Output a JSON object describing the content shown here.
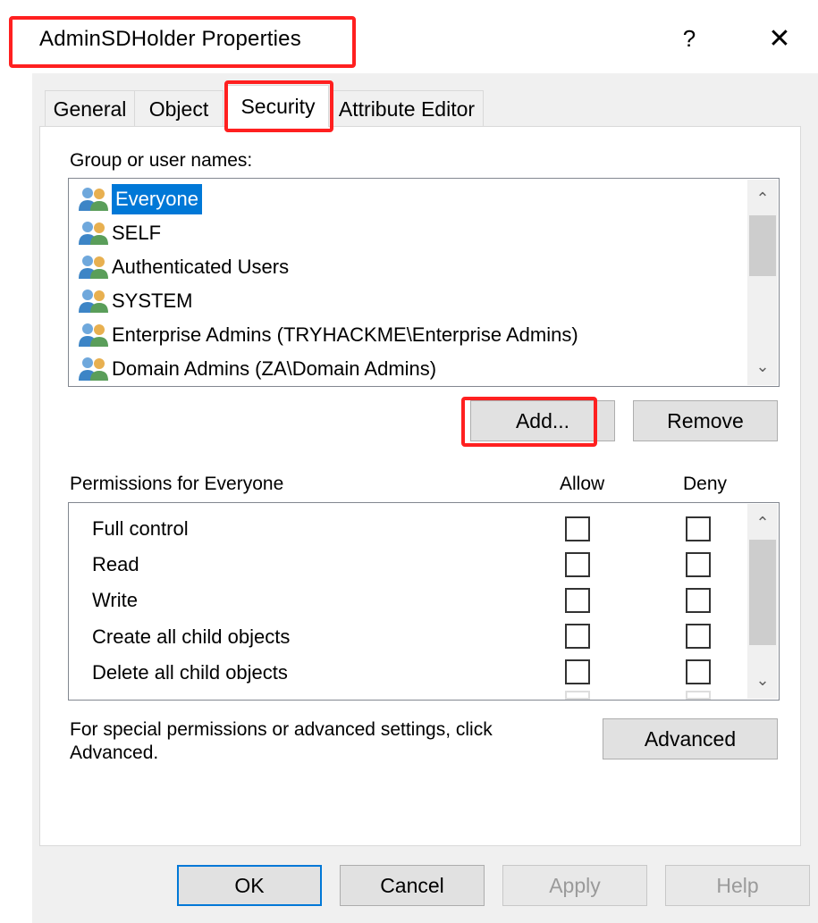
{
  "window": {
    "title": "AdminSDHolder Properties",
    "help_glyph": "?",
    "close_glyph": "✕"
  },
  "tabs": [
    {
      "label": "General",
      "active": false
    },
    {
      "label": "Object",
      "active": false
    },
    {
      "label": "Security",
      "active": true
    },
    {
      "label": "Attribute Editor",
      "active": false
    }
  ],
  "security": {
    "group_label": "Group or user names:",
    "users": [
      {
        "name": "Everyone",
        "selected": true,
        "icon": "users-group-icon"
      },
      {
        "name": "SELF",
        "selected": false,
        "icon": "users-group-icon"
      },
      {
        "name": "Authenticated Users",
        "selected": false,
        "icon": "users-group-icon"
      },
      {
        "name": "SYSTEM",
        "selected": false,
        "icon": "users-group-icon"
      },
      {
        "name": "Enterprise Admins (TRYHACKME\\Enterprise Admins)",
        "selected": false,
        "icon": "users-group-icon"
      },
      {
        "name": "Domain Admins (ZA\\Domain Admins)",
        "selected": false,
        "icon": "users-group-icon"
      }
    ],
    "add_label": "Add...",
    "remove_label": "Remove",
    "permissions_label": "Permissions for Everyone",
    "allow_header": "Allow",
    "deny_header": "Deny",
    "permissions": [
      {
        "name": "Full control",
        "allow": false,
        "deny": false
      },
      {
        "name": "Read",
        "allow": false,
        "deny": false
      },
      {
        "name": "Write",
        "allow": false,
        "deny": false
      },
      {
        "name": "Create all child objects",
        "allow": false,
        "deny": false
      },
      {
        "name": "Delete all child objects",
        "allow": false,
        "deny": false
      }
    ],
    "advanced_text": "For special permissions or advanced settings, click Advanced.",
    "advanced_label": "Advanced"
  },
  "footer": {
    "ok": "OK",
    "cancel": "Cancel",
    "apply": "Apply",
    "help": "Help"
  },
  "scroll_arrows": {
    "up": "⌃",
    "down": "⌄"
  },
  "colors": {
    "selection": "#0078d7",
    "highlight": "#ff2020",
    "dialog_bg": "#f0f0f0"
  }
}
